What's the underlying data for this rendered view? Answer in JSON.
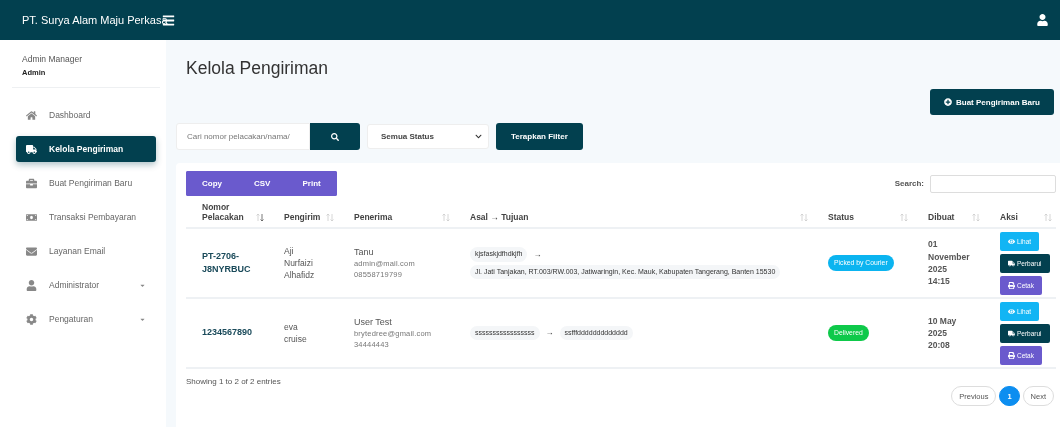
{
  "navbar": {
    "brand": "PT. Surya Alam Maju Perkasa"
  },
  "sidebar": {
    "user_name": "Admin Manager",
    "role": "Admin",
    "items": [
      {
        "label": "Dashboard",
        "selected": false,
        "has_submenu": false
      },
      {
        "label": "Kelola Pengiriman",
        "selected": true,
        "has_submenu": false
      },
      {
        "label": "Buat Pengiriman Baru",
        "selected": false,
        "has_submenu": false
      },
      {
        "label": "Transaksi Pembayaran",
        "selected": false,
        "has_submenu": false
      },
      {
        "label": "Layanan Email",
        "selected": false,
        "has_submenu": false
      },
      {
        "label": "Administrator",
        "selected": false,
        "has_submenu": true
      },
      {
        "label": "Pengaturan",
        "selected": false,
        "has_submenu": true
      }
    ]
  },
  "page": {
    "title": "Kelola Pengiriman",
    "new_button": "Buat Pengiriman Baru"
  },
  "filter": {
    "search_placeholder": "Cari nomor pelacakan/nama/",
    "status_select": "Semua Status",
    "apply_button": "Terapkan Filter"
  },
  "export_buttons": [
    "Copy",
    "CSV",
    "Print"
  ],
  "table_search": {
    "label": "Search:"
  },
  "table": {
    "columns": [
      {
        "label": "Nomor\nPelacakan",
        "sorted": true
      },
      {
        "label": "Pengirim",
        "sorted": false
      },
      {
        "label": "Penerima",
        "sorted": false
      },
      {
        "label": "Asal → Tujuan",
        "sorted": false
      },
      {
        "label": "Status",
        "sorted": false
      },
      {
        "label": "Dibuat",
        "sorted": false
      },
      {
        "label": "Aksi",
        "sorted": false
      }
    ],
    "rows": [
      {
        "tracking": "PT-2706-\nJ8NYRBUC",
        "sender": "Aji\nNurfaizi\nAlhafidz",
        "receiver": {
          "name": "Tanu",
          "email": "admin@mail.com",
          "phone": "08558719799"
        },
        "route": {
          "origin": "kjsfaskjdfhdkjfh",
          "arrow": "→",
          "destination": "Jl. Jati Tanjakan, RT.003/RW.003, Jatiwaringin, Kec. Mauk, Kabupaten Tangerang, Banten 15530"
        },
        "status": {
          "label": "Picked by Courier",
          "color": "#0bb4f0"
        },
        "created": "01\nNovember\n2025\n14:15",
        "actions": [
          {
            "label": "Lihat",
            "kind": "view"
          },
          {
            "label": "Perbarui",
            "kind": "update"
          },
          {
            "label": "Cetak",
            "kind": "print"
          }
        ]
      },
      {
        "tracking": "1234567890",
        "sender": "eva\ncruise",
        "receiver": {
          "name": "User Test",
          "email": "brytedree@gmail.com",
          "phone": "34444443"
        },
        "route": {
          "origin": "sssssssssssssssss",
          "arrow": "→",
          "destination": "ssfffddddddddddddd"
        },
        "status": {
          "label": "Delivered",
          "color": "#0ec94a"
        },
        "created": "10 May\n2025\n20:08",
        "actions": [
          {
            "label": "Lihat",
            "kind": "view"
          },
          {
            "label": "Perbarui",
            "kind": "update"
          },
          {
            "label": "Cetak",
            "kind": "print"
          }
        ]
      }
    ]
  },
  "footer": {
    "info": "Showing 1 to 2 of 2 entries"
  },
  "pagination": [
    {
      "label": "Previous",
      "selected": false
    },
    {
      "label": "1",
      "selected": true
    },
    {
      "label": "Next",
      "selected": false
    }
  ]
}
